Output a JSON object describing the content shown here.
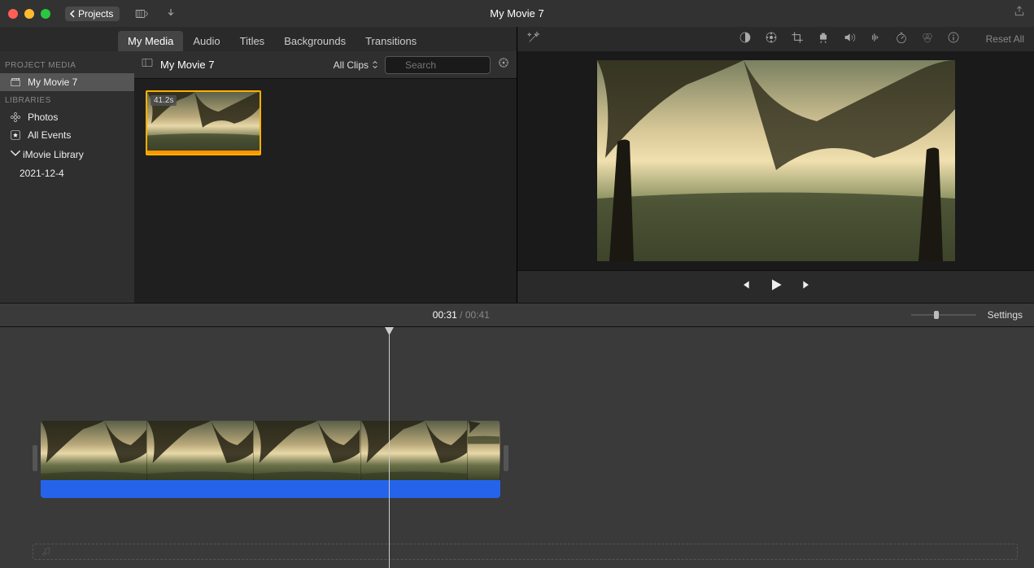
{
  "window": {
    "title": "My Movie 7"
  },
  "titlebar": {
    "projects_label": "Projects"
  },
  "browser": {
    "tabs": [
      "My Media",
      "Audio",
      "Titles",
      "Backgrounds",
      "Transitions"
    ],
    "active_tab": 0,
    "sidebar": {
      "project_media_hdr": "PROJECT MEDIA",
      "project_name": "My Movie 7",
      "libraries_hdr": "LIBRARIES",
      "photos": "Photos",
      "all_events": "All Events",
      "library_name": "iMovie Library",
      "event_name": "2021-12-4"
    },
    "media_bar": {
      "crumb": "My Movie 7",
      "filter": "All Clips",
      "search_placeholder": "Search"
    },
    "clip": {
      "duration": "41.2s"
    }
  },
  "viewer": {
    "reset_label": "Reset All"
  },
  "timeline_header": {
    "current": "00:31",
    "sep": " / ",
    "total": "00:41",
    "settings": "Settings"
  }
}
